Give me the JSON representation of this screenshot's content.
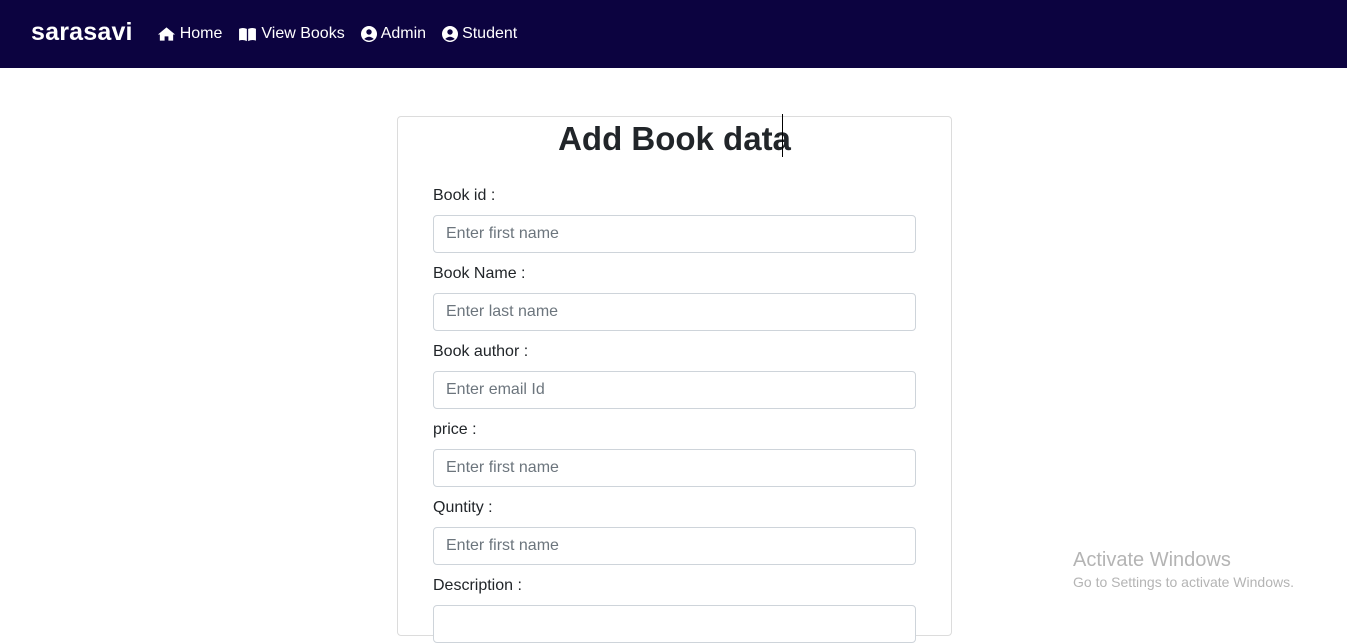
{
  "navbar": {
    "brand": "sarasavi",
    "items": [
      {
        "label": "Home",
        "icon": "home-icon"
      },
      {
        "label": "View Books",
        "icon": "book-icon"
      },
      {
        "label": "Admin",
        "icon": "user-circle-icon"
      },
      {
        "label": "Student",
        "icon": "user-circle-icon"
      }
    ]
  },
  "form": {
    "title": "Add Book data",
    "fields": [
      {
        "label": "Book id :",
        "placeholder": "Enter first name"
      },
      {
        "label": "Book Name :",
        "placeholder": "Enter last name"
      },
      {
        "label": "Book author :",
        "placeholder": "Enter email Id"
      },
      {
        "label": "price :",
        "placeholder": "Enter first name"
      },
      {
        "label": "Quntity :",
        "placeholder": "Enter first name"
      },
      {
        "label": "Description :",
        "placeholder": ""
      }
    ]
  },
  "watermark": {
    "title": "Activate Windows",
    "subtitle": "Go to Settings to activate Windows."
  },
  "colors": {
    "navbar_bg": "#0c0340",
    "nav_text": "#ffffff"
  }
}
